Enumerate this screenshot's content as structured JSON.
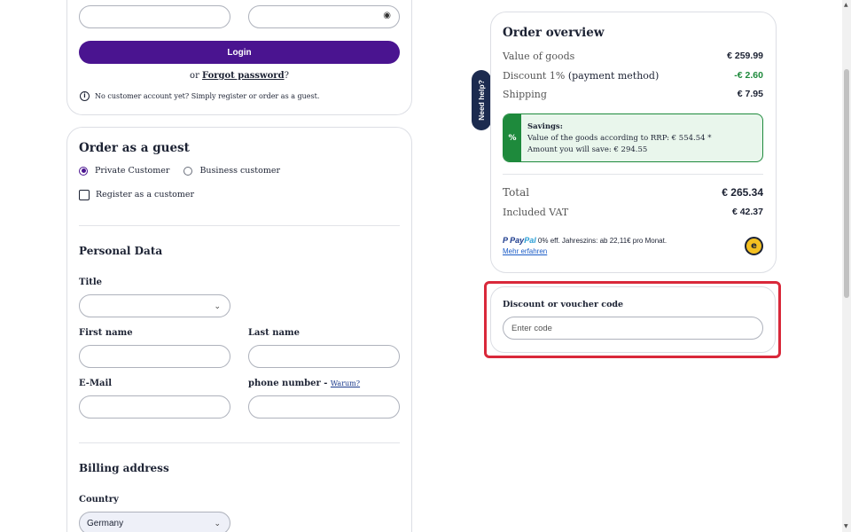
{
  "login": {
    "button_label": "Login",
    "or_text": "or ",
    "forgot_link": "Forgot password",
    "forgot_suffix": "?",
    "no_account_text": "No customer account yet? Simply register or order as a guest."
  },
  "guest": {
    "title": "Order as a guest",
    "private_label": "Private Customer",
    "business_label": "Business customer",
    "register_label": "Register as a customer"
  },
  "personal": {
    "title": "Personal Data",
    "title_label": "Title",
    "first_name_label": "First name",
    "last_name_label": "Last name",
    "email_label": "E-Mail",
    "phone_label": "phone number - ",
    "phone_why_link": "Warum?"
  },
  "billing": {
    "title": "Billing address",
    "country_label": "Country",
    "country_value": "Germany"
  },
  "need_help": "Need help?",
  "overview": {
    "title": "Order overview",
    "value_goods_label": "Value of goods",
    "value_goods": "€ 259.99",
    "discount_label": "Discount 1% ",
    "discount_method": "(payment method)",
    "discount_value": "-€ 2.60",
    "shipping_label": "Shipping",
    "shipping_value": "€ 7.95",
    "savings_title": "Savings:",
    "savings_rrp": "Value of the goods according to RRP: € 554.54 *",
    "savings_amount": "Amount you will save: € 294.55",
    "total_label": "Total",
    "total_value": "€ 265.34",
    "vat_label": "Included VAT",
    "vat_value": "€ 42.37",
    "paypal_logo_pay": "Pay",
    "paypal_logo_pal": "Pal",
    "paypal_text": " 0% eff. Jahreszins: ab 22,11€ pro Monat.",
    "paypal_link": "Mehr erfahren"
  },
  "voucher": {
    "label": "Discount or voucher code",
    "placeholder": "Enter code"
  },
  "colors": {
    "primary": "#4a1490",
    "green": "#1e8a3c",
    "highlight": "#d9283a",
    "dark": "#1c2b4f"
  }
}
